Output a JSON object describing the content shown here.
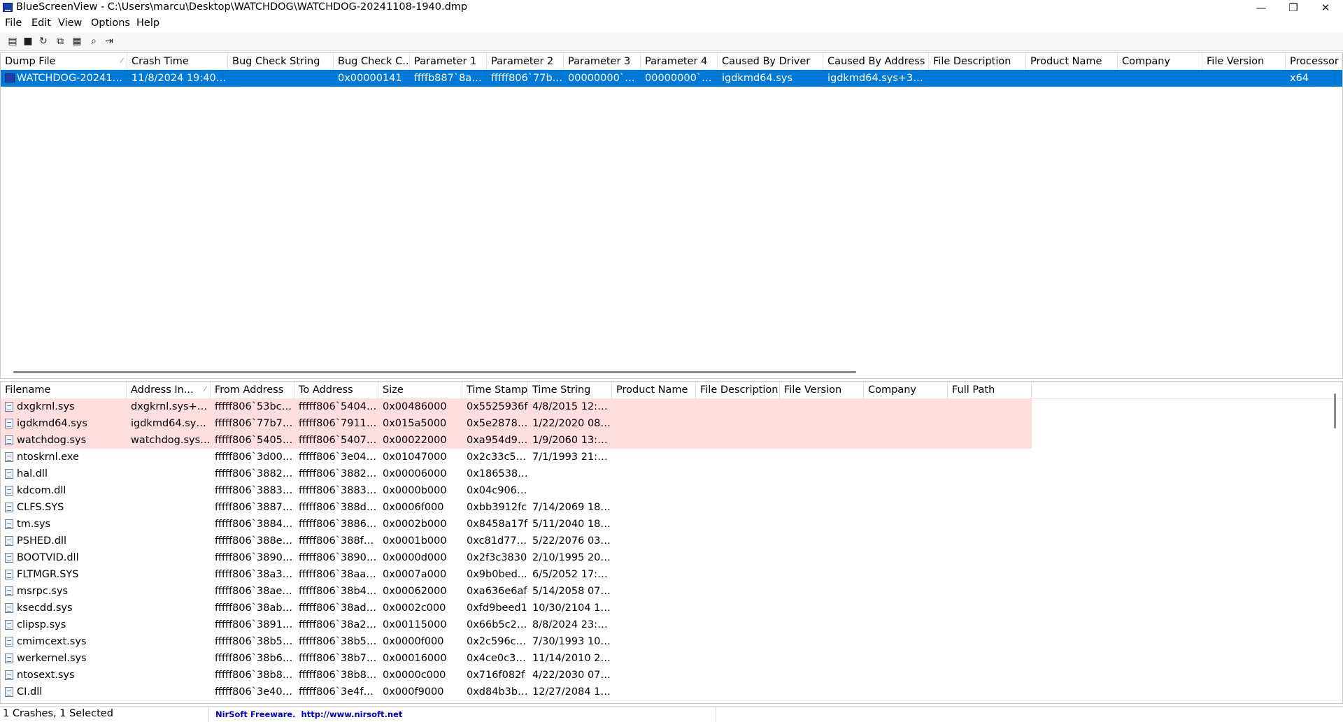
{
  "window": {
    "title": "BlueScreenView  -  C:\\Users\\marcu\\Desktop\\WATCHDOG\\WATCHDOG-20241108-1940.dmp",
    "minimize_glyph": "—",
    "maximize_glyph": "❐",
    "close_glyph": "✕"
  },
  "menu": [
    "File",
    "Edit",
    "View",
    "Options",
    "Help"
  ],
  "toolbar": [
    {
      "icon": "properties-icon",
      "glyph": "▤"
    },
    {
      "icon": "save-icon",
      "glyph": "■"
    },
    {
      "icon": "refresh-icon",
      "glyph": "↻"
    },
    {
      "icon": "copy-icon",
      "glyph": "⧉"
    },
    {
      "icon": "html-report-icon",
      "glyph": "▦"
    },
    {
      "icon": "find-icon",
      "glyph": "⌕"
    },
    {
      "icon": "exit-icon",
      "glyph": "⇥"
    }
  ],
  "crash_table": {
    "columns": [
      "Dump File",
      "Crash Time",
      "Bug Check String",
      "Bug Check C...",
      "Parameter 1",
      "Parameter 2",
      "Parameter 3",
      "Parameter 4",
      "Caused By Driver",
      "Caused By Address",
      "File Description",
      "Product Name",
      "Company",
      "File Version",
      "Processor"
    ],
    "rows": [
      [
        "WATCHDOG-2024110...",
        "11/8/2024 19:40:54",
        "",
        "0x00000141",
        "ffffb887`8ad...",
        "fffff806`77ba...",
        "00000000`00...",
        "00000000`00...",
        "igdkmd64.sys",
        "igdkmd64.sys+3a8a0",
        "",
        "",
        "",
        "",
        "x64"
      ]
    ]
  },
  "driver_table": {
    "columns": [
      "Filename",
      "Address In...",
      "From Address",
      "To Address",
      "Size",
      "Time Stamp",
      "Time String",
      "Product Name",
      "File Description",
      "File Version",
      "Company",
      "Full Path"
    ],
    "rows": [
      [
        "dxgkrnl.sys",
        "dxgkrnl.sys+30...",
        "fffff806`53bc0...",
        "fffff806`54046...",
        "0x00486000",
        "0x5525936f",
        "4/8/2015 12:45..."
      ],
      [
        "igdkmd64.sys",
        "igdkmd64.sys+...",
        "fffff806`77b70...",
        "fffff806`79115...",
        "0x015a5000",
        "0x5e28786e",
        "1/22/2020 08:2..."
      ],
      [
        "watchdog.sys",
        "watchdog.sys+...",
        "fffff806`54050...",
        "fffff806`54072...",
        "0x00022000",
        "0xa954d94a",
        "1/9/2060 13:42..."
      ],
      [
        "ntoskrnl.exe",
        "",
        "fffff806`3d000...",
        "fffff806`3e047...",
        "0x01047000",
        "0x2c33c508",
        "7/1/1993 21:18..."
      ],
      [
        "hal.dll",
        "",
        "fffff806`38820...",
        "fffff806`38826...",
        "0x00006000",
        "0x1865382a",
        ""
      ],
      [
        "kdcom.dll",
        "",
        "fffff806`38830...",
        "fffff806`3883b...",
        "0x0000b000",
        "0x04c90611",
        ""
      ],
      [
        "CLFS.SYS",
        "",
        "fffff806`38870...",
        "fffff806`388df0...",
        "0x0006f000",
        "0xbb3912fc",
        "7/14/2069 18:1..."
      ],
      [
        "tm.sys",
        "",
        "fffff806`38840...",
        "fffff806`3886b...",
        "0x0002b000",
        "0x8458a17f",
        "5/11/2040 18:0..."
      ],
      [
        "PSHED.dll",
        "",
        "fffff806`388e0...",
        "fffff806`388fb0...",
        "0x0001b000",
        "0xc81d7731",
        "5/22/2076 03:5..."
      ],
      [
        "BOOTVID.dll",
        "",
        "fffff806`38900...",
        "fffff806`3890d...",
        "0x0000d000",
        "0x2f3c3830",
        "2/10/1995 20:0..."
      ],
      [
        "FLTMGR.SYS",
        "",
        "fffff806`38a30...",
        "fffff806`38aaa...",
        "0x0007a000",
        "0x9b0bed...",
        "6/5/2052 17:30..."
      ],
      [
        "msrpc.sys",
        "",
        "fffff806`38ae0...",
        "fffff806`38b42...",
        "0x00062000",
        "0xa636e6af",
        "5/14/2058 07:3..."
      ],
      [
        "ksecdd.sys",
        "",
        "fffff806`38ab0...",
        "fffff806`38adc...",
        "0x0002c000",
        "0xfd9beed1",
        "10/30/2104 16:..."
      ],
      [
        "clipsp.sys",
        "",
        "fffff806`38910...",
        "fffff806`38a25...",
        "0x00115000",
        "0x66b5c2a4",
        "8/8/2024 23:17..."
      ],
      [
        "cmimcext.sys",
        "",
        "fffff806`38b50...",
        "fffff806`38b5f0...",
        "0x0000f000",
        "0x2c596c69",
        "7/30/1993 10:4..."
      ],
      [
        "werkernel.sys",
        "",
        "fffff806`38b60...",
        "fffff806`38b76...",
        "0x00016000",
        "0x4ce0c321",
        "11/14/2010 21:..."
      ],
      [
        "ntosext.sys",
        "",
        "fffff806`38b80...",
        "fffff806`38b8c...",
        "0x0000c000",
        "0x716f082f",
        "4/22/2030 07:2..."
      ],
      [
        "CI.dll",
        "",
        "fffff806`3e400...",
        "fffff806`3e4f90...",
        "0x000f9000",
        "0xd84b3b40",
        "12/27/2084 18:..."
      ]
    ],
    "highlighted_rows": 3
  },
  "status": {
    "count": "1 Crashes, 1 Selected",
    "link": "NirSoft Freeware.  http://www.nirsoft.net"
  },
  "colors": {
    "selection": "#0078d7",
    "highlight_row": "#ffdede",
    "link": "#0000cc"
  }
}
